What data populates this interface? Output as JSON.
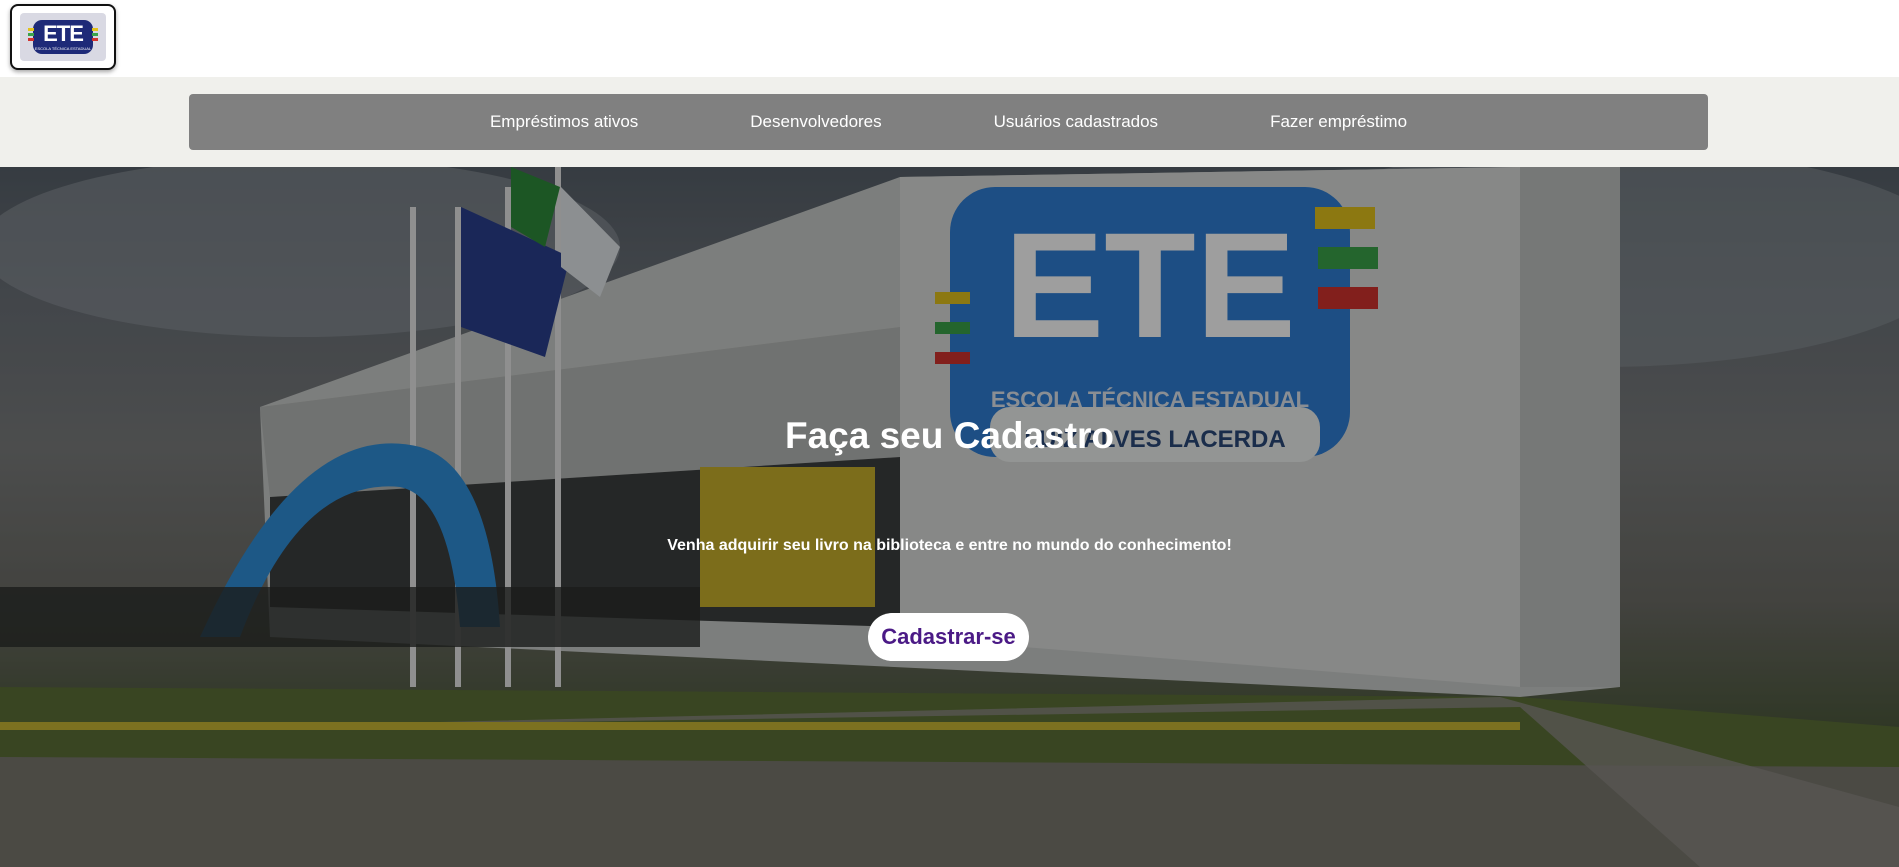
{
  "logo": {
    "text": "ETE",
    "subtext": "ESCOLA TÉCNICA ESTADUAL"
  },
  "nav": {
    "items": [
      {
        "label": "Empréstimos ativos"
      },
      {
        "label": "Desenvolvedores"
      },
      {
        "label": "Usuários cadastrados"
      },
      {
        "label": "Fazer empréstimo"
      }
    ]
  },
  "hero": {
    "title": "Faça seu Cadastro",
    "subtitle": "Venha adquirir seu livro na biblioteca e entre no mundo do conhecimento!",
    "button_label": "Cadastrar-se",
    "sign_text": "ETE",
    "sign_school": "ESCOLA TÉCNICA ESTADUAL",
    "sign_name": "LUIZ ALVES LACERDA"
  },
  "colors": {
    "nav_bg": "#808080",
    "nav_strip_bg": "#f0f0ec",
    "button_text": "#4b1a86",
    "sign_blue": "#2f7fd6"
  }
}
